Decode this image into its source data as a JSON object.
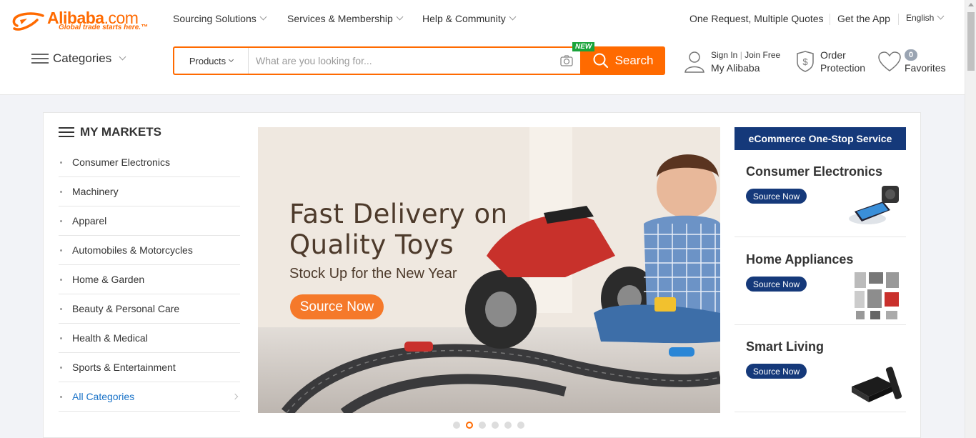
{
  "logo": {
    "word": "Alibaba",
    "com": ".com",
    "tagline": "Global trade starts here.",
    "tm": "™"
  },
  "topnav": {
    "sourcing": "Sourcing Solutions",
    "services": "Services & Membership",
    "help": "Help & Community",
    "rfq": "One Request, Multiple Quotes",
    "app": "Get the App",
    "language": "English"
  },
  "categories_label": "Categories",
  "search": {
    "category": "Products",
    "placeholder": "What are you looking for...",
    "button": "Search",
    "new_badge": "NEW"
  },
  "user": {
    "sign_in": "Sign In",
    "divider": "|",
    "join": "Join Free",
    "my_alibaba": "My Alibaba",
    "order": "Order",
    "protection": "Protection",
    "favorites_count": "0",
    "favorites": "Favorites"
  },
  "markets": {
    "title": "MY MARKETS",
    "items": [
      "Consumer Electronics",
      "Machinery",
      "Apparel",
      "Automobiles & Motorcycles",
      "Home & Garden",
      "Beauty & Personal Care",
      "Health & Medical",
      "Sports & Entertainment"
    ],
    "all": "All Categories"
  },
  "banner": {
    "title_line1": "Fast Delivery on",
    "title_line2": "Quality Toys",
    "subtitle": "Stock Up for the New Year",
    "button": "Source Now",
    "slide_count": 6,
    "active_slide": 2
  },
  "ecommerce": {
    "header": "eCommerce One-Stop Service",
    "items": [
      {
        "title": "Consumer Electronics",
        "button": "Source Now"
      },
      {
        "title": "Home Appliances",
        "button": "Source Now"
      },
      {
        "title": "Smart Living",
        "button": "Source Now"
      }
    ]
  },
  "colors": {
    "brand_orange": "#ff6a00",
    "navy": "#15397a",
    "link_blue": "#1a73c8",
    "new_green": "#1aa33a"
  }
}
